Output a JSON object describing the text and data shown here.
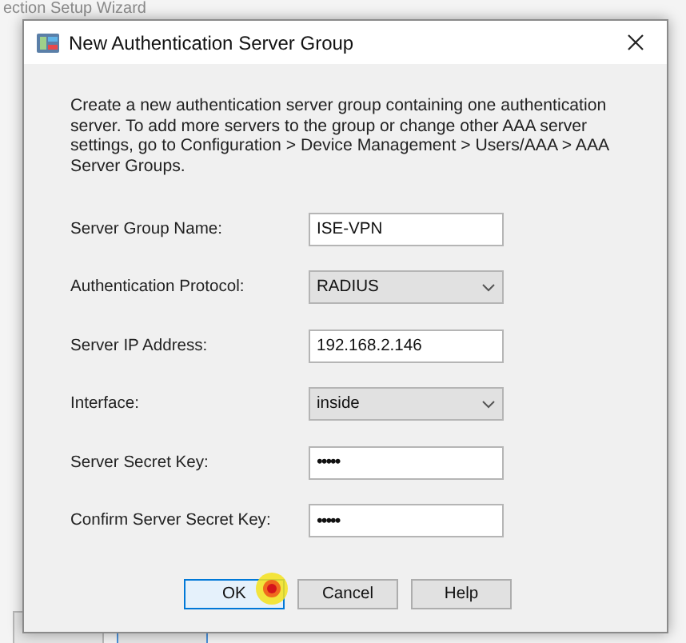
{
  "background_window": {
    "title": "ection Setup Wizard"
  },
  "dialog": {
    "title": "New Authentication Server Group",
    "description": "Create a new authentication server group containing one authentication server. To add more servers to the group or change other AAA server settings, go to Configuration > Device Management > Users/AAA > AAA Server Groups.",
    "fields": [
      {
        "kind": "text",
        "label": "Server Group Name:",
        "value": "ISE-VPN"
      },
      {
        "kind": "select",
        "label": "Authentication Protocol:",
        "value": "RADIUS"
      },
      {
        "kind": "text",
        "label": "Server IP Address:",
        "value": "192.168.2.146"
      },
      {
        "kind": "select",
        "label": "Interface:",
        "value": "inside"
      },
      {
        "kind": "password",
        "label": "Server Secret Key:",
        "value": "•••••"
      },
      {
        "kind": "password",
        "label": "Confirm Server Secret Key:",
        "value": "•••••"
      }
    ],
    "buttons": [
      {
        "label": "OK",
        "default": true
      },
      {
        "label": "Cancel",
        "default": false
      },
      {
        "label": "Help",
        "default": false
      }
    ]
  }
}
